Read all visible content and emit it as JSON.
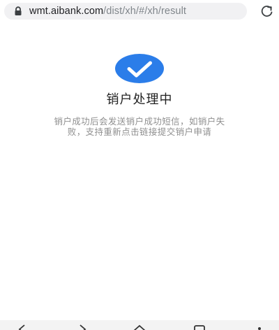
{
  "browser": {
    "url_host": "wmt.aibank.com",
    "url_path": "/dist/xh/#/xh/result",
    "icons": {
      "lock": "lock-icon",
      "reload": "reload-icon"
    }
  },
  "result": {
    "status_icon": "check-circle-icon",
    "accent_color": "#2b7de9",
    "title": "销户处理中",
    "description": "销户成功后会发送销户成功短信，如销户失败，支持重新点击链接提交销户申请"
  },
  "navbar": {
    "icons": [
      "back-icon",
      "forward-icon",
      "home-icon",
      "tabs-icon",
      "menu-icon"
    ]
  }
}
